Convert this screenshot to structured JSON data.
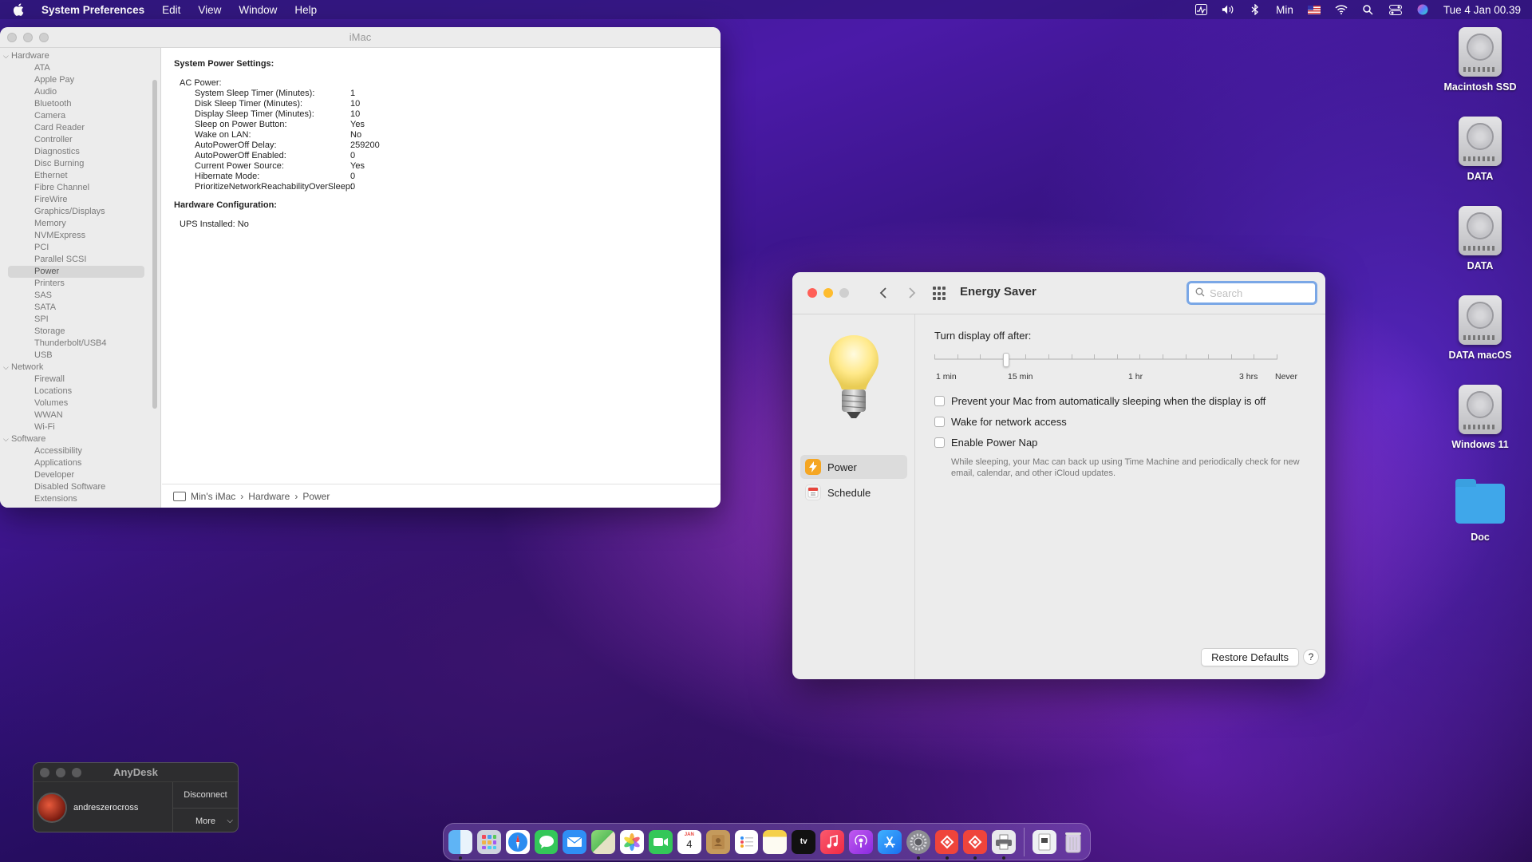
{
  "menubar": {
    "app_name": "System Preferences",
    "menus": [
      "Edit",
      "View",
      "Window",
      "Help"
    ],
    "user": "Min",
    "clock": "Tue 4 Jan  00.39"
  },
  "sysinfo": {
    "window_title": "iMac",
    "sidebar": {
      "hardware_label": "Hardware",
      "hardware_items": [
        "ATA",
        "Apple Pay",
        "Audio",
        "Bluetooth",
        "Camera",
        "Card Reader",
        "Controller",
        "Diagnostics",
        "Disc Burning",
        "Ethernet",
        "Fibre Channel",
        "FireWire",
        "Graphics/Displays",
        "Memory",
        "NVMExpress",
        "PCI",
        "Parallel SCSI",
        "Power",
        "Printers",
        "SAS",
        "SATA",
        "SPI",
        "Storage",
        "Thunderbolt/USB4",
        "USB"
      ],
      "selected": "Power",
      "network_label": "Network",
      "network_items": [
        "Firewall",
        "Locations",
        "Volumes",
        "WWAN",
        "Wi-Fi"
      ],
      "software_label": "Software",
      "software_items": [
        "Accessibility",
        "Applications",
        "Developer",
        "Disabled Software",
        "Extensions"
      ]
    },
    "content": {
      "heading1": "System Power Settings:",
      "ac_label": "AC Power:",
      "settings": [
        {
          "k": "System Sleep Timer (Minutes):",
          "v": "1"
        },
        {
          "k": "Disk Sleep Timer (Minutes):",
          "v": "10"
        },
        {
          "k": "Display Sleep Timer (Minutes):",
          "v": "10"
        },
        {
          "k": "Sleep on Power Button:",
          "v": "Yes"
        },
        {
          "k": "Wake on LAN:",
          "v": "No"
        },
        {
          "k": "AutoPowerOff Delay:",
          "v": "259200"
        },
        {
          "k": "AutoPowerOff Enabled:",
          "v": "0"
        },
        {
          "k": "Current Power Source:",
          "v": "Yes"
        },
        {
          "k": "Hibernate Mode:",
          "v": "0"
        },
        {
          "k": "PrioritizeNetworkReachabilityOverSleep:",
          "v": "0"
        }
      ],
      "heading2": "Hardware Configuration:",
      "ups": "UPS Installed:  No"
    },
    "pathbar": {
      "mac": "Min's iMac",
      "sep": "›",
      "section": "Hardware",
      "page": "Power"
    }
  },
  "energy": {
    "window_title": "Energy Saver",
    "search_placeholder": "Search",
    "nav": [
      {
        "label": "Power",
        "icon": "power-icon",
        "color": "#f5a623",
        "active": true
      },
      {
        "label": "Schedule",
        "icon": "calendar-icon",
        "color": "#f0f0f0",
        "active": false
      }
    ],
    "display_off_label": "Turn display off after:",
    "slider_value": "10 min",
    "tick_labels": [
      "1 min",
      "15 min",
      "1 hr",
      "3 hrs",
      "Never"
    ],
    "options": [
      {
        "label": "Prevent your Mac from automatically sleeping when the display is off",
        "checked": false
      },
      {
        "label": "Wake for network access",
        "checked": false
      },
      {
        "label": "Enable Power Nap",
        "checked": false
      }
    ],
    "power_nap_desc": "While sleeping, your Mac can back up using Time Machine and periodically check for new email, calendar, and other iCloud updates.",
    "restore_label": "Restore Defaults",
    "help_label": "?"
  },
  "desktop_icons": [
    "Macintosh SSD",
    "DATA",
    "DATA",
    "DATA macOS",
    "Windows 11",
    "Doc"
  ],
  "anydesk": {
    "title": "AnyDesk",
    "user": "andreszerocross",
    "disconnect": "Disconnect",
    "more": "More"
  },
  "dock": {
    "calendar_day": "4",
    "apps": [
      "finder",
      "launchpad",
      "safari",
      "messages",
      "mail",
      "maps",
      "photos",
      "facetime",
      "calendar",
      "contacts",
      "reminders",
      "notes",
      "tv",
      "music",
      "podcasts",
      "app-store",
      "system-preferences",
      "anydesk",
      "anydesk-2",
      "printer",
      "downloads",
      "trash"
    ]
  },
  "colors": {
    "accent": "#007aff",
    "close": "#ff5f57",
    "minimize": "#febc2e"
  }
}
